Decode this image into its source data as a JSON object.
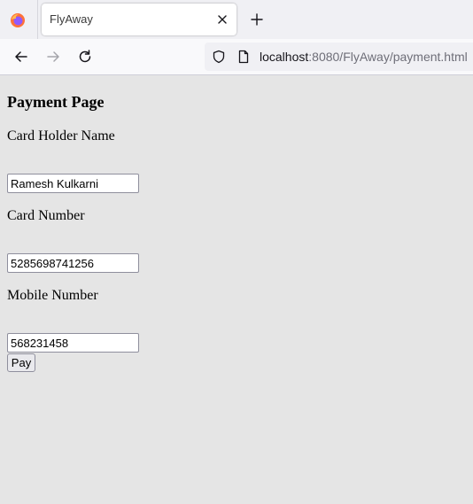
{
  "browser": {
    "tab": {
      "title": "FlyAway"
    },
    "url": {
      "host": "localhost",
      "rest": ":8080/FlyAway/payment.html"
    }
  },
  "page": {
    "title": "Payment Page",
    "fields": [
      {
        "label": "Card Holder Name",
        "value": "Ramesh Kulkarni"
      },
      {
        "label": "Card Number",
        "value": "5285698741256"
      },
      {
        "label": "Mobile Number",
        "value": "568231458"
      }
    ],
    "pay_button": "Pay"
  }
}
